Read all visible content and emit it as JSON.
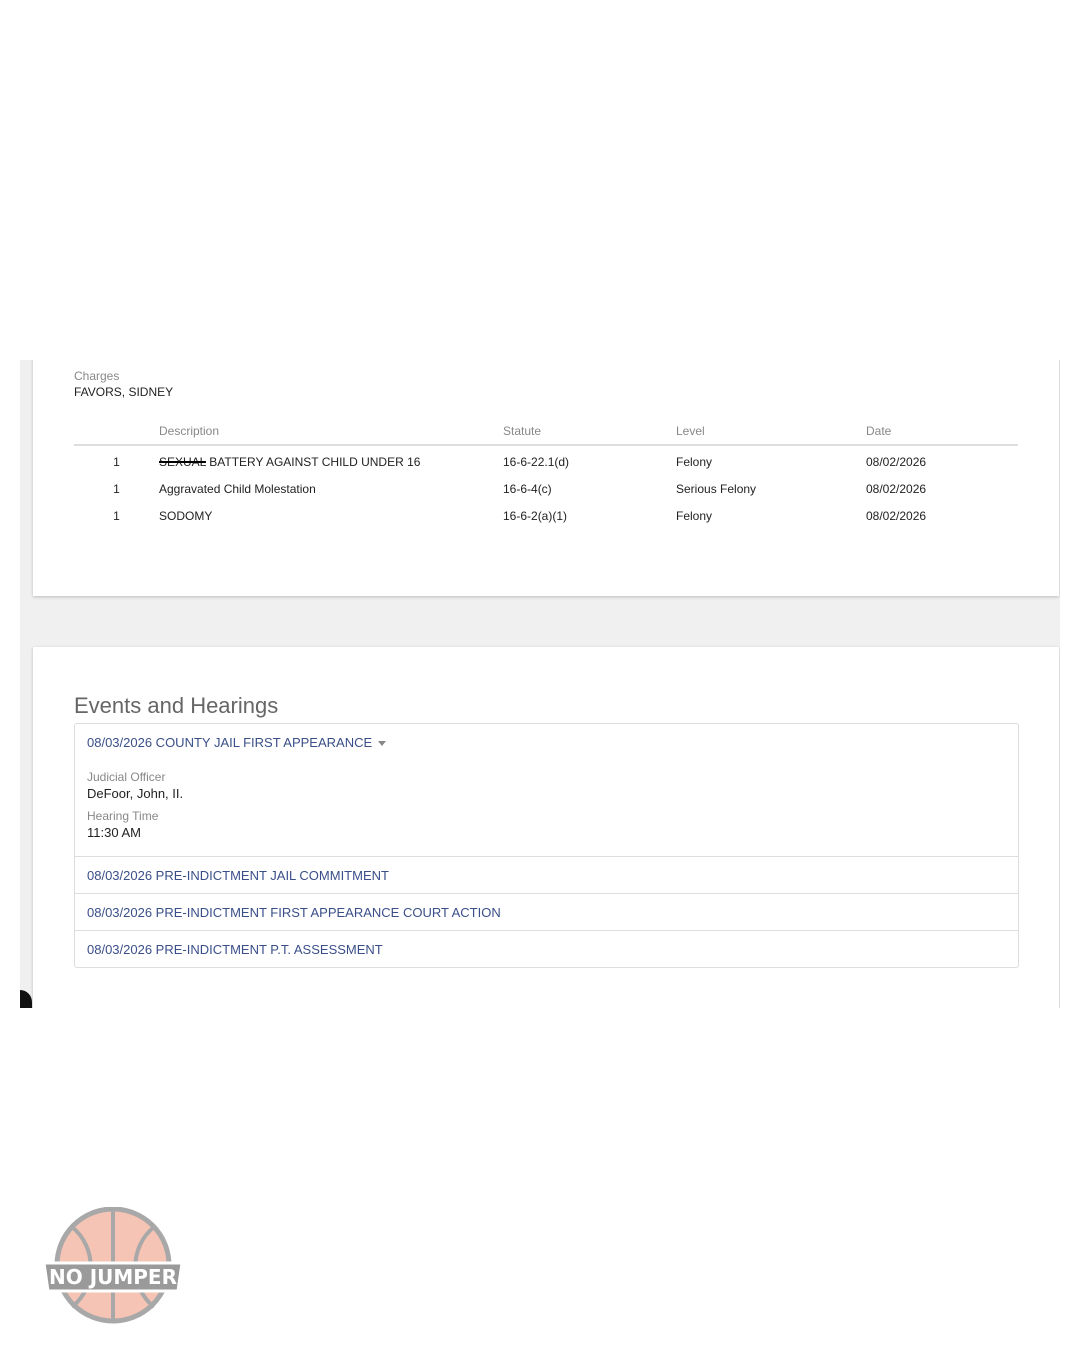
{
  "charges": {
    "section_label": "Charges",
    "party_name": "FAVORS, SIDNEY",
    "columns": [
      "",
      "Description",
      "Statute",
      "Level",
      "Date"
    ],
    "rows": [
      {
        "count": "1",
        "desc_struck": "SEXUAL",
        "description": "BATTERY AGAINST CHILD UNDER 16",
        "statute": "16-6-22.1(d)",
        "level": "Felony",
        "date": "08/02/2026"
      },
      {
        "count": "1",
        "desc_struck": "",
        "description": "Aggravated Child Molestation",
        "statute": "16-6-4(c)",
        "level": "Serious Felony",
        "date": "08/02/2026"
      },
      {
        "count": "1",
        "desc_struck": "",
        "description": "SODOMY",
        "statute": "16-6-2(a)(1)",
        "level": "Felony",
        "date": "08/02/2026"
      }
    ]
  },
  "events": {
    "title": "Events and Hearings",
    "items": [
      {
        "label": "08/03/2026 COUNTY JAIL FIRST APPEARANCE",
        "judicial_officer_label": "Judicial Officer",
        "judicial_officer": "DeFoor, John, II.",
        "hearing_time_label": "Hearing Time",
        "hearing_time": "11:30 AM"
      },
      {
        "label": "08/03/2026 PRE-INDICTMENT JAIL COMMITMENT"
      },
      {
        "label": "08/03/2026 PRE-INDICTMENT FIRST APPEARANCE COURT ACTION"
      },
      {
        "label": "08/03/2026 PRE-INDICTMENT P.T. ASSESSMENT"
      }
    ]
  },
  "watermark": {
    "text": "NO JUMPER"
  },
  "colors": {
    "link": "#3a4f8a",
    "muted": "#888888",
    "logo_ball": "#f5c4b5"
  }
}
